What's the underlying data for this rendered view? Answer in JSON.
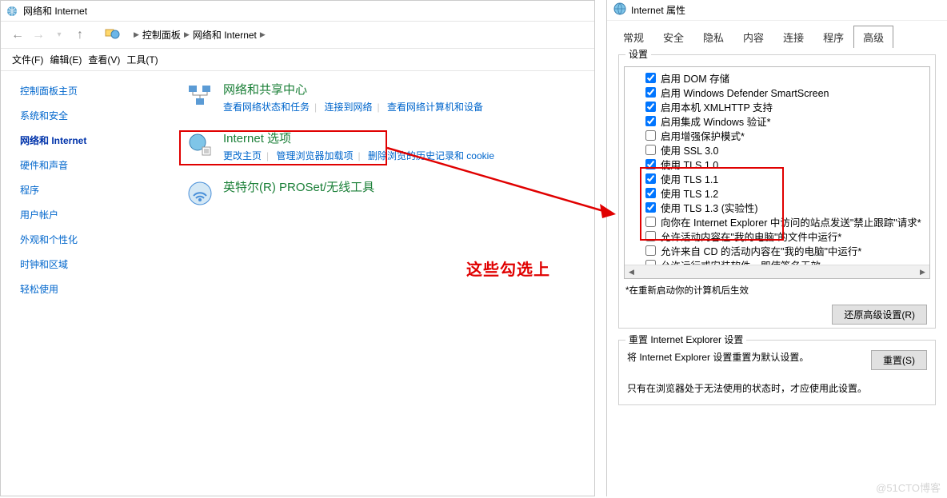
{
  "left": {
    "windowTitle": "网络和 Internet",
    "breadcrumb": {
      "root": "控制面板",
      "current": "网络和 Internet"
    },
    "menu": {
      "file": "文件(F)",
      "edit": "编辑(E)",
      "view": "查看(V)",
      "tools": "工具(T)"
    },
    "sidebar": [
      {
        "label": "控制面板主页",
        "active": false
      },
      {
        "label": "系统和安全",
        "active": false
      },
      {
        "label": "网络和 Internet",
        "active": true
      },
      {
        "label": "硬件和声音",
        "active": false
      },
      {
        "label": "程序",
        "active": false
      },
      {
        "label": "用户帐户",
        "active": false
      },
      {
        "label": "外观和个性化",
        "active": false
      },
      {
        "label": "时钟和区域",
        "active": false
      },
      {
        "label": "轻松使用",
        "active": false
      }
    ],
    "items": [
      {
        "title": "网络和共享中心",
        "links": [
          "查看网络状态和任务",
          "连接到网络",
          "查看网络计算机和设备"
        ]
      },
      {
        "title": "Internet 选项",
        "links": [
          "更改主页",
          "管理浏览器加载项",
          "删除浏览的历史记录和 cookie"
        ]
      },
      {
        "title": "英特尔(R) PROSet/无线工具",
        "links": []
      }
    ]
  },
  "annotation": "这些勾选上",
  "right": {
    "title": "Internet 属性",
    "tabs": [
      "常规",
      "安全",
      "隐私",
      "内容",
      "连接",
      "程序",
      "高级"
    ],
    "activeTabIndex": 6,
    "settingsLabel": "设置",
    "checkboxes": [
      {
        "label": "启用 DOM 存储",
        "checked": true
      },
      {
        "label": "启用 Windows Defender SmartScreen",
        "checked": true
      },
      {
        "label": "启用本机 XMLHTTP 支持",
        "checked": true
      },
      {
        "label": "启用集成 Windows 验证*",
        "checked": true
      },
      {
        "label": "启用增强保护模式*",
        "checked": false
      },
      {
        "label": "使用 SSL 3.0",
        "checked": false
      },
      {
        "label": "使用 TLS 1.0",
        "checked": true
      },
      {
        "label": "使用 TLS 1.1",
        "checked": true
      },
      {
        "label": "使用 TLS 1.2",
        "checked": true
      },
      {
        "label": "使用 TLS 1.3  (实验性)",
        "checked": true
      },
      {
        "label": "向你在 Internet Explorer 中访问的站点发送\"禁止跟踪\"请求*",
        "checked": false
      },
      {
        "label": "允许活动内容在\"我的电脑\"的文件中运行*",
        "checked": false
      },
      {
        "label": "允许来自 CD 的活动内容在\"我的电脑\"中运行*",
        "checked": false
      },
      {
        "label": "允许运行或安装软件，即使签名无效",
        "checked": false
      }
    ],
    "restartNote": "*在重新启动你的计算机后生效",
    "restoreButton": "还原高级设置(R)",
    "resetLabel": "重置 Internet Explorer 设置",
    "resetDesc": "将 Internet Explorer 设置重置为默认设置。",
    "resetButton": "重置(S)",
    "resetNote": "只有在浏览器处于无法使用的状态时，才应使用此设置。"
  },
  "watermark": "@51CTO博客"
}
